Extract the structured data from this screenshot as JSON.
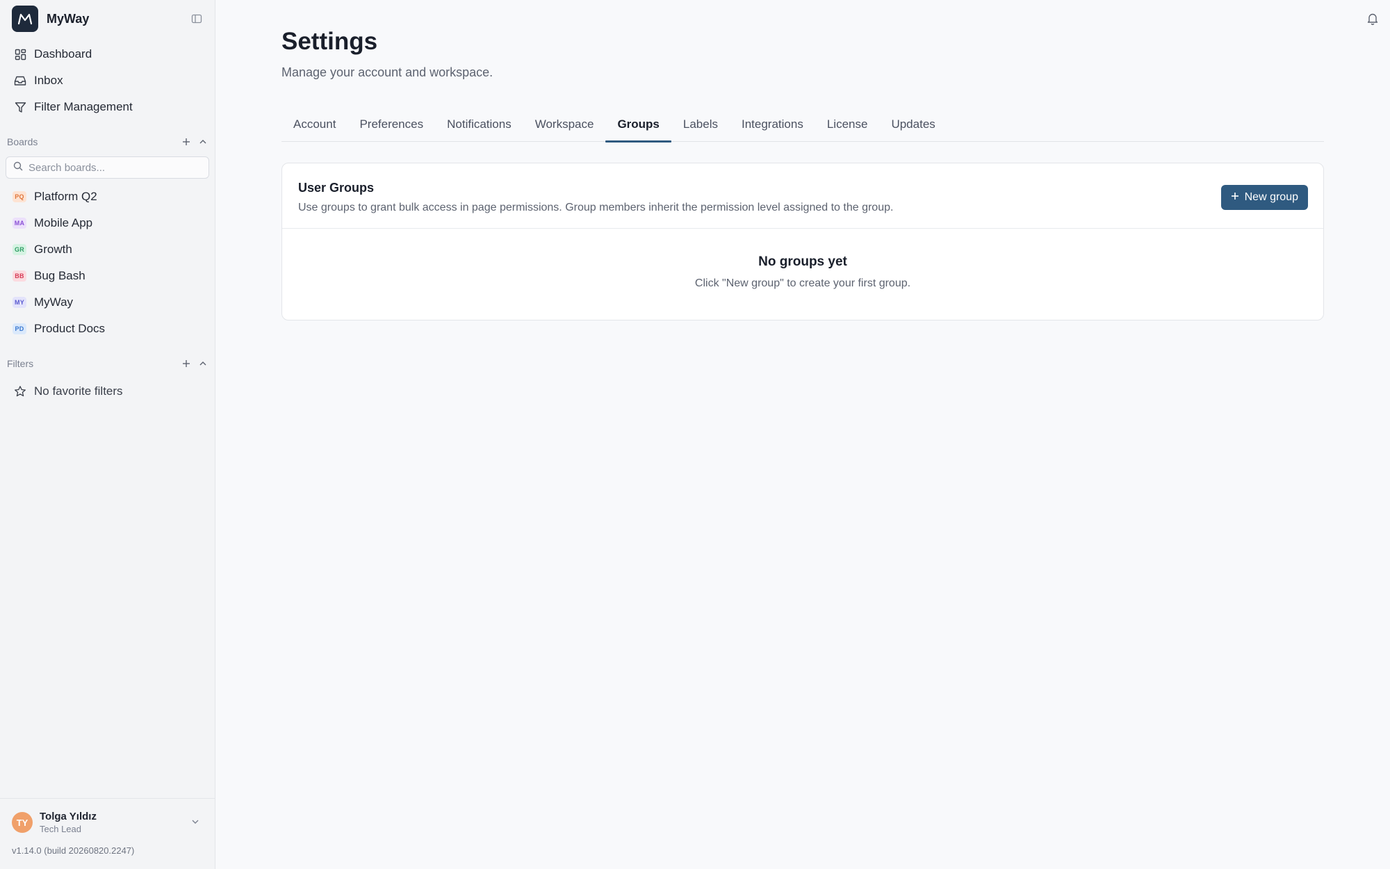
{
  "app": {
    "name": "MyWay"
  },
  "sidebar": {
    "nav": [
      {
        "label": "Dashboard",
        "icon": "grid-icon"
      },
      {
        "label": "Inbox",
        "icon": "inbox-icon"
      },
      {
        "label": "Filter Management",
        "icon": "filter-icon"
      }
    ],
    "boards_section": {
      "title": "Boards",
      "search_placeholder": "Search boards...",
      "items": [
        {
          "badge": "PQ",
          "label": "Platform Q2",
          "badge_bg": "#fde3d3",
          "badge_fg": "#e0753a"
        },
        {
          "badge": "MA",
          "label": "Mobile App",
          "badge_bg": "#ece0fb",
          "badge_fg": "#8a50d6"
        },
        {
          "badge": "GR",
          "label": "Growth",
          "badge_bg": "#d6f3e3",
          "badge_fg": "#2f9e64"
        },
        {
          "badge": "BB",
          "label": "Bug Bash",
          "badge_bg": "#fbdbe0",
          "badge_fg": "#d63a55"
        },
        {
          "badge": "MY",
          "label": "MyWay",
          "badge_bg": "#e3e3fb",
          "badge_fg": "#5a5ad0"
        },
        {
          "badge": "PD",
          "label": "Product Docs",
          "badge_bg": "#dbe9fb",
          "badge_fg": "#3a78d0"
        }
      ]
    },
    "filters_section": {
      "title": "Filters",
      "empty_label": "No favorite filters"
    },
    "user": {
      "initials": "TY",
      "name": "Tolga Yıldız",
      "role": "Tech Lead"
    },
    "version": "v1.14.0 (build 20260820.2247)"
  },
  "main": {
    "title": "Settings",
    "subtitle": "Manage your account and workspace.",
    "tabs": [
      {
        "label": "Account",
        "active": false
      },
      {
        "label": "Preferences",
        "active": false
      },
      {
        "label": "Notifications",
        "active": false
      },
      {
        "label": "Workspace",
        "active": false
      },
      {
        "label": "Groups",
        "active": true
      },
      {
        "label": "Labels",
        "active": false
      },
      {
        "label": "Integrations",
        "active": false
      },
      {
        "label": "License",
        "active": false
      },
      {
        "label": "Updates",
        "active": false
      }
    ],
    "groups_card": {
      "title": "User Groups",
      "description": "Use groups to grant bulk access in page permissions. Group members inherit the permission level assigned to the group.",
      "new_button_label": "New group",
      "empty_title": "No groups yet",
      "empty_description": "Click \"New group\" to create your first group."
    }
  },
  "colors": {
    "accent": "#2f5a80",
    "avatar": "#f0a06a"
  }
}
